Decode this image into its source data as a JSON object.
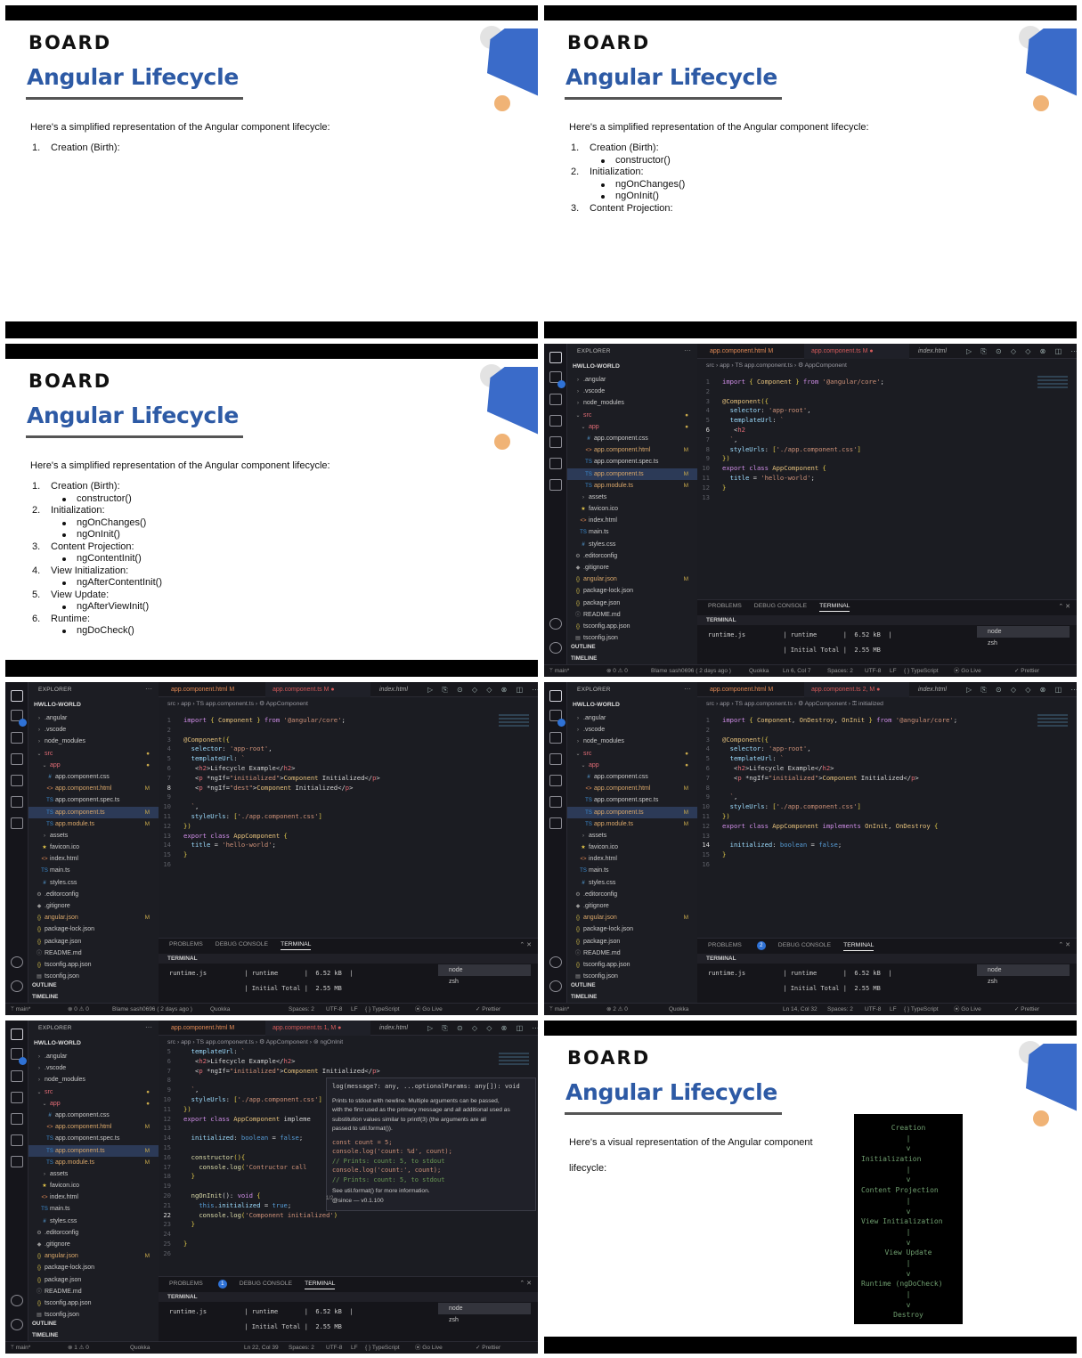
{
  "slides": {
    "logo": "BOARD",
    "title": "Angular Lifecycle",
    "intro": "Here's a simplified representation of the Angular component lifecycle:",
    "intro_visual_1": "Here's a visual representation of the Angular component",
    "intro_visual_2": "lifecycle:",
    "steps": [
      {
        "num": "1.",
        "label": "Creation (Birth):",
        "hooks": [
          "constructor()"
        ]
      },
      {
        "num": "2.",
        "label": "Initialization:",
        "hooks": [
          "ngOnChanges()",
          "ngOnInit()"
        ]
      },
      {
        "num": "3.",
        "label": "Content Projection:",
        "hooks": [
          "ngContentInit()"
        ]
      },
      {
        "num": "4.",
        "label": "View Initialization:",
        "hooks": [
          "ngAfterContentInit()"
        ]
      },
      {
        "num": "5.",
        "label": "View Update:",
        "hooks": [
          "ngAfterViewInit()"
        ]
      },
      {
        "num": "6.",
        "label": "Runtime:",
        "hooks": [
          "ngDoCheck()"
        ]
      }
    ],
    "diagram": [
      "Creation",
      "|",
      "v",
      "Initialization",
      "|",
      "v",
      "Content Projection",
      "|",
      "v",
      "View Initialization",
      "|",
      "v",
      "View Update",
      "|",
      "v",
      "Runtime (ngDoCheck)",
      "|",
      "v",
      "Destroy"
    ]
  },
  "vscode": {
    "explorer_label": "EXPLORER",
    "explorer_more": "···",
    "project": "HWLLO-WORLD",
    "files": [
      {
        "name": ".angular",
        "ico": "›",
        "indent": 1
      },
      {
        "name": ".vscode",
        "ico": "›",
        "indent": 1
      },
      {
        "name": "node_modules",
        "ico": "›",
        "indent": 1
      },
      {
        "name": "src",
        "ico": "⌄",
        "indent": 1,
        "color": "#e06c75",
        "status": "●"
      },
      {
        "name": "app",
        "ico": "⌄",
        "indent": 2,
        "color": "#e06c75",
        "status": "●"
      },
      {
        "name": "app.component.css",
        "ico": "#",
        "indent": 3
      },
      {
        "name": "app.component.html",
        "ico": "<>",
        "indent": 3,
        "modified": true,
        "status": "M"
      },
      {
        "name": "app.component.spec.ts",
        "ico": "TS",
        "indent": 3
      },
      {
        "name": "app.component.ts",
        "ico": "TS",
        "indent": 3,
        "modified": true,
        "status": "M",
        "selected": true
      },
      {
        "name": "app.module.ts",
        "ico": "TS",
        "indent": 3,
        "modified": true,
        "status": "M"
      },
      {
        "name": "assets",
        "ico": "›",
        "indent": 2
      },
      {
        "name": "favicon.ico",
        "ico": "★",
        "indent": 2
      },
      {
        "name": "index.html",
        "ico": "<>",
        "indent": 2
      },
      {
        "name": "main.ts",
        "ico": "TS",
        "indent": 2
      },
      {
        "name": "styles.css",
        "ico": "#",
        "indent": 2
      },
      {
        "name": ".editorconfig",
        "ico": "⚙",
        "indent": 1
      },
      {
        "name": ".gitignore",
        "ico": "◆",
        "indent": 1
      },
      {
        "name": "angular.json",
        "ico": "{}",
        "indent": 1,
        "modified": true,
        "status": "M"
      },
      {
        "name": "package-lock.json",
        "ico": "{}",
        "indent": 1
      },
      {
        "name": "package.json",
        "ico": "{}",
        "indent": 1
      },
      {
        "name": "README.md",
        "ico": "ⓘ",
        "indent": 1
      },
      {
        "name": "tsconfig.app.json",
        "ico": "{}",
        "indent": 1
      },
      {
        "name": "tsconfig.json",
        "ico": "▤",
        "indent": 1
      }
    ],
    "outline": "OUTLINE",
    "timeline": "TIMELINE",
    "tab_html": "app.component.html  M",
    "tab_index": "index.html",
    "crumb_base": "src  ›  app  ›  TS app.component.ts  ›  ⚙ AppComponent",
    "panel_tabs": [
      "PROBLEMS",
      "DEBUG CONSOLE",
      "TERMINAL"
    ],
    "terminal_header": "TERMINAL",
    "terminal_line1": "runtime.js          | runtime       |  6.52 kB  |",
    "terminal_line2": "                    | Initial Total |  2.55 MB",
    "terminals": [
      "node",
      "zsh"
    ],
    "status_branch": "ᛘ main*",
    "status_quokka": "Quokka",
    "status_spaces": "Spaces: 2",
    "status_enc": "UTF-8",
    "status_eol": "LF",
    "status_lang": "{ } TypeScript",
    "status_golive": "⦿ Go Live",
    "status_prettier": "✓ Prettier",
    "status_blame": "Blame sash0696 ( 2 days ago )",
    "editors": [
      {
        "tab_ts": "app.component.ts  M  ●",
        "crumb_tail": "",
        "problems_badge": "",
        "status_errors": "⊗ 0 ⚠ 0",
        "status_pos": "Ln 6, Col 7",
        "cur_line": "6",
        "lines": [
          [
            "1",
            "import { Component } from '@angular/core';"
          ],
          [
            "2",
            ""
          ],
          [
            "3",
            "@Component({"
          ],
          [
            "4",
            "  selector: 'app-root',"
          ],
          [
            "5",
            "  templateUrl: `"
          ],
          [
            "6",
            "   <h2"
          ],
          [
            "7",
            "  `,"
          ],
          [
            "8",
            "  styleUrls: ['./app.component.css']"
          ],
          [
            "9",
            "})"
          ],
          [
            "10",
            "export class AppComponent {"
          ],
          [
            "11",
            "  title = 'hello-world';"
          ],
          [
            "12",
            "}"
          ],
          [
            "13",
            ""
          ]
        ]
      },
      {
        "tab_ts": "app.component.ts  M  ●",
        "crumb_tail": "",
        "problems_badge": "",
        "status_errors": "⊗ 0 ⚠ 0",
        "status_pos": "",
        "cur_line": "8",
        "lines": [
          [
            "1",
            "import { Component } from '@angular/core';"
          ],
          [
            "2",
            ""
          ],
          [
            "3",
            "@Component({"
          ],
          [
            "4",
            "  selector: 'app-root',"
          ],
          [
            "5",
            "  templateUrl: `"
          ],
          [
            "6",
            "   <h2>Lifecycle Example</h2>"
          ],
          [
            "7",
            "   <p *ngIf=\"initialized\">Component Initialized</p>"
          ],
          [
            "8",
            "   <p *ngIf=\"dest\">Component Initialized</p>"
          ],
          [
            "9",
            ""
          ],
          [
            "10",
            "  `,"
          ],
          [
            "11",
            "  styleUrls: ['./app.component.css']"
          ],
          [
            "12",
            "})"
          ],
          [
            "13",
            "export class AppComponent {"
          ],
          [
            "14",
            "  title = 'hello-world';"
          ],
          [
            "15",
            "}"
          ],
          [
            "16",
            ""
          ]
        ]
      },
      {
        "tab_ts": "app.component.ts  2, M  ●",
        "crumb_tail": "  ›  ⚿ initialized",
        "problems_badge": "2",
        "status_errors": "⊗ 2 ⚠ 0",
        "status_pos": "Ln 14, Col 32",
        "cur_line": "14",
        "lines": [
          [
            "1",
            "import { Component, OnDestroy, OnInit } from '@angular/core';"
          ],
          [
            "2",
            ""
          ],
          [
            "3",
            "@Component({"
          ],
          [
            "4",
            "  selector: 'app-root',"
          ],
          [
            "5",
            "  templateUrl: `"
          ],
          [
            "6",
            "   <h2>Lifecycle Example</h2>"
          ],
          [
            "7",
            "   <p *ngIf=\"initialized\">Component Initialized</p>"
          ],
          [
            "8",
            ""
          ],
          [
            "9",
            "  `,"
          ],
          [
            "10",
            "  styleUrls: ['./app.component.css']"
          ],
          [
            "11",
            "})"
          ],
          [
            "12",
            "export class AppComponent implements OnInit, OnDestroy {"
          ],
          [
            "13",
            ""
          ],
          [
            "14",
            "  initialized: boolean = false;"
          ],
          [
            "15",
            "}"
          ],
          [
            "16",
            ""
          ]
        ]
      },
      {
        "tab_ts": "app.component.ts  1, M  ●",
        "crumb_tail": "  ›  ⊚ ngOnInit",
        "problems_badge": "1",
        "status_errors": "⊗ 1 ⚠ 0",
        "status_pos": "Ln 22, Col 39",
        "cur_line": "22",
        "lines": [
          [
            "5",
            "  templateUrl: `"
          ],
          [
            "6",
            "   <h2>Lifecycle Example</h2>"
          ],
          [
            "7",
            "   <p *ngIf=\"initialized\">Component Initialized</p>"
          ],
          [
            "8",
            ""
          ],
          [
            "9",
            "  `,"
          ],
          [
            "10",
            "  styleUrls: ['./app.component.css']"
          ],
          [
            "11",
            "})"
          ],
          [
            "12",
            "export class AppComponent impleme"
          ],
          [
            "13",
            ""
          ],
          [
            "14",
            "  initialized: boolean = false;"
          ],
          [
            "15",
            ""
          ],
          [
            "16",
            "  constructor(){"
          ],
          [
            "17",
            "    console.log('Contructor call"
          ],
          [
            "18",
            "  }"
          ],
          [
            "19",
            ""
          ],
          [
            "20",
            "  ngOnInit(): void {"
          ],
          [
            "21",
            "    this.initialized = true;"
          ],
          [
            "22",
            "    console.log('Component initialized')"
          ],
          [
            "23",
            "  }"
          ],
          [
            "24",
            ""
          ],
          [
            "25",
            "}"
          ],
          [
            "26",
            ""
          ]
        ],
        "hover": {
          "signature": "log(message?: any, ...optionalParams: any[]): void",
          "d1": "Prints to stdout with newline. Multiple arguments can be passed,",
          "d2": "with the first used as the primary message and all additional used as",
          "d3": "substitution values similar to printf(3) (the arguments are all",
          "d4": "passed to util.format()).",
          "c1": "const count = 5;",
          "c2": "console.log('count: %d', count);",
          "c3": "// Prints: count: 5, to stdout",
          "c4": "console.log('count:', count);",
          "c5": "// Prints: count: 5, to stdout",
          "see": "See util.format() for more information.",
          "since": "@since — v0.1.100",
          "pager": "1/2"
        }
      }
    ]
  }
}
